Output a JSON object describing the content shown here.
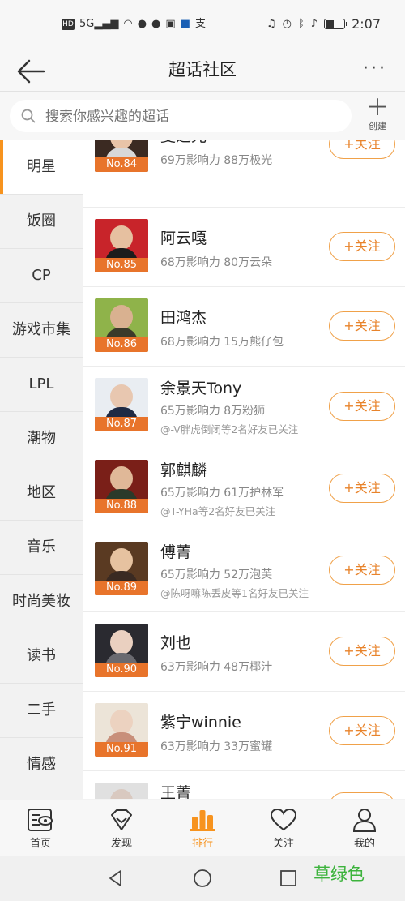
{
  "status_bar": {
    "left_icons": [
      "HD",
      "5G",
      "signal-icon",
      "wifi-icon",
      "wechat-icon",
      "wechat-icon",
      "baidu-icon",
      "app-icon",
      "alipay-icon"
    ],
    "time": "2:07"
  },
  "title_bar": {
    "title": "超话社区",
    "more": "···"
  },
  "search": {
    "placeholder": "搜索你感兴趣的超话",
    "create_label": "创建"
  },
  "categories": [
    {
      "label": "明星",
      "active": true
    },
    {
      "label": "饭圈"
    },
    {
      "label": "CP"
    },
    {
      "label": "游戏市集"
    },
    {
      "label": "LPL"
    },
    {
      "label": "潮物"
    },
    {
      "label": "地区"
    },
    {
      "label": "音乐"
    },
    {
      "label": "时尚美妆"
    },
    {
      "label": "读书"
    },
    {
      "label": "二手"
    },
    {
      "label": "情感"
    }
  ],
  "ranking": [
    {
      "name": "夏之光",
      "meta": "69万影响力 88万极光",
      "friend": "",
      "rank": "No.84"
    },
    {
      "name": "阿云嘎",
      "meta": "68万影响力 80万云朵",
      "friend": "",
      "rank": "No.85"
    },
    {
      "name": "田鸿杰",
      "meta": "68万影响力 15万熊仔包",
      "friend": "",
      "rank": "No.86"
    },
    {
      "name": "余景天Tony",
      "meta": "65万影响力 8万粉狮",
      "friend": "@-V胖虎倒闭等2名好友已关注",
      "rank": "No.87"
    },
    {
      "name": "郭麒麟",
      "meta": "65万影响力 61万护林军",
      "friend": "@T-YHa等2名好友已关注",
      "rank": "No.88"
    },
    {
      "name": "傅菁",
      "meta": "65万影响力 52万泡芙",
      "friend": "@陈呀嘛陈丢皮等1名好友已关注",
      "rank": "No.89"
    },
    {
      "name": "刘也",
      "meta": "63万影响力 48万椰汁",
      "friend": "",
      "rank": "No.90"
    },
    {
      "name": "紫宁winnie",
      "meta": "63万影响力 33万蜜罐",
      "friend": "",
      "rank": "No.91"
    },
    {
      "name": "王菁",
      "meta": "",
      "friend": "",
      "rank": ""
    }
  ],
  "follow_label": "+关注",
  "tabs": [
    {
      "label": "首页",
      "icon": "home-icon"
    },
    {
      "label": "发现",
      "icon": "discover-icon"
    },
    {
      "label": "排行",
      "icon": "rank-icon",
      "active": true
    },
    {
      "label": "关注",
      "icon": "heart-icon"
    },
    {
      "label": "我的",
      "icon": "profile-icon"
    }
  ],
  "overlay_text": "草绿色",
  "colors": {
    "accent": "#f7931e",
    "rank_badge": "#e8742b",
    "follow_border": "#f0a149"
  }
}
